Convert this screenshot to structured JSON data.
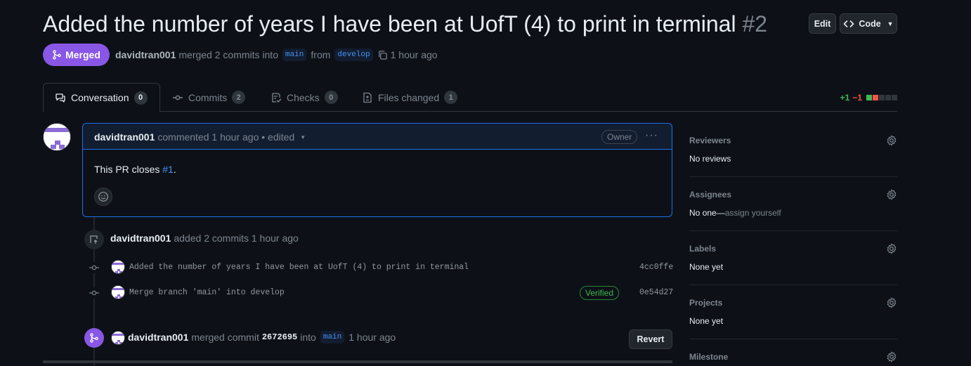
{
  "header": {
    "title": "Added the number of years I have been at UofT (4) to print in terminal",
    "number": "#2",
    "edit_label": "Edit",
    "code_label": "Code"
  },
  "status": {
    "badge": "Merged",
    "author": "davidtran001",
    "text_merged": "merged 2 commits into",
    "base_branch": "main",
    "text_from": "from",
    "head_branch": "develop",
    "time": "1 hour ago"
  },
  "tabs": [
    {
      "label": "Conversation",
      "count": "0",
      "active": true
    },
    {
      "label": "Commits",
      "count": "2"
    },
    {
      "label": "Checks",
      "count": "0"
    },
    {
      "label": "Files changed",
      "count": "1"
    }
  ],
  "diffstat": {
    "additions": "+1",
    "deletions": "−1"
  },
  "comment": {
    "author": "davidtran001",
    "meta": "commented 1 hour ago • edited",
    "badge": "Owner",
    "body_prefix": "This PR closes",
    "body_link": "#1",
    "body_suffix": "."
  },
  "push_event": {
    "author": "davidtran001",
    "text": "added 2 commits 1 hour ago"
  },
  "commits": [
    {
      "message": "Added the number of years I have been at UofT (4) to print in terminal",
      "sha": "4cc0ffe"
    },
    {
      "message": "Merge branch 'main' into develop",
      "sha": "0e54d27",
      "badge": "Verified"
    }
  ],
  "merge_event": {
    "author": "davidtran001",
    "text_merged": "merged commit",
    "sha": "2672695",
    "text_into": "into",
    "branch": "main",
    "time": "1 hour ago",
    "revert_label": "Revert"
  },
  "sidebar": {
    "reviewers": {
      "label": "Reviewers",
      "value": "No reviews"
    },
    "assignees": {
      "label": "Assignees",
      "value": "No one—",
      "link": "assign yourself"
    },
    "labels": {
      "label": "Labels",
      "value": "None yet"
    },
    "projects": {
      "label": "Projects",
      "value": "None yet"
    },
    "milestone": {
      "label": "Milestone"
    }
  },
  "colors": {
    "background": "#0d1117",
    "merged": "#8957e5",
    "link": "#4493f8",
    "addition": "#3fb950",
    "deletion": "#f85149"
  }
}
